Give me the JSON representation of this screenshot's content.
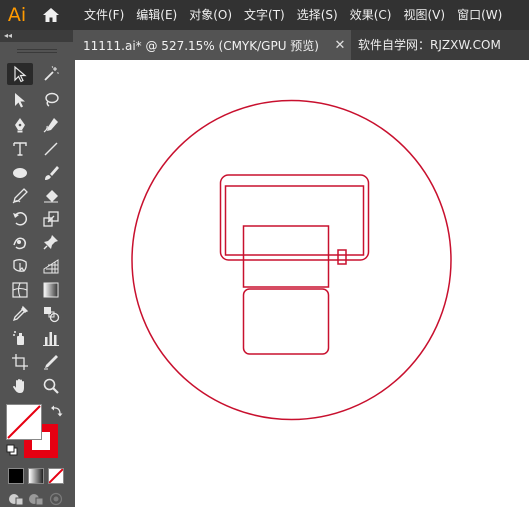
{
  "app": {
    "logo": "Ai"
  },
  "menu": [
    "文件(F)",
    "编辑(E)",
    "对象(O)",
    "文字(T)",
    "选择(S)",
    "效果(C)",
    "视图(V)",
    "窗口(W)"
  ],
  "document": {
    "tab_title": "11111.ai* @ 527.15% (CMYK/GPU 预览)",
    "close": "✕"
  },
  "watermark": "软件自学网：RJZXW.COM",
  "toolbar": {
    "collapse": "◂◂"
  },
  "colors": {
    "menubar": "#323232",
    "panel": "#535353",
    "tab_inactive": "#3c3c3c",
    "stroke": "#E60012",
    "artwork": "#C8102E",
    "canvas": "#FFFFFF",
    "logo": "#FF9A00"
  },
  "icons": [
    "home-icon",
    "selection-tool-icon",
    "magic-wand-icon",
    "direct-selection-icon",
    "lasso-icon",
    "pen-icon",
    "curvature-icon",
    "type-icon",
    "line-icon",
    "ellipse-icon",
    "paintbrush-icon",
    "pencil-icon",
    "eraser-icon",
    "rotate-icon",
    "scale-icon",
    "puppet-warp-icon",
    "pin-icon",
    "free-transform-icon",
    "perspective-grid-icon",
    "mesh-icon",
    "gradient-icon",
    "eyedropper-icon",
    "blend-icon",
    "symbol-sprayer-icon",
    "graph-icon",
    "artboard-icon",
    "slice-icon",
    "hand-icon",
    "zoom-icon",
    "fill-swatch-icon",
    "stroke-swatch-icon",
    "swap-icon",
    "default-colors-icon",
    "color-mode-icon",
    "gradient-mode-icon",
    "none-mode-icon",
    "draw-normal-icon",
    "draw-behind-icon",
    "draw-inside-icon"
  ]
}
